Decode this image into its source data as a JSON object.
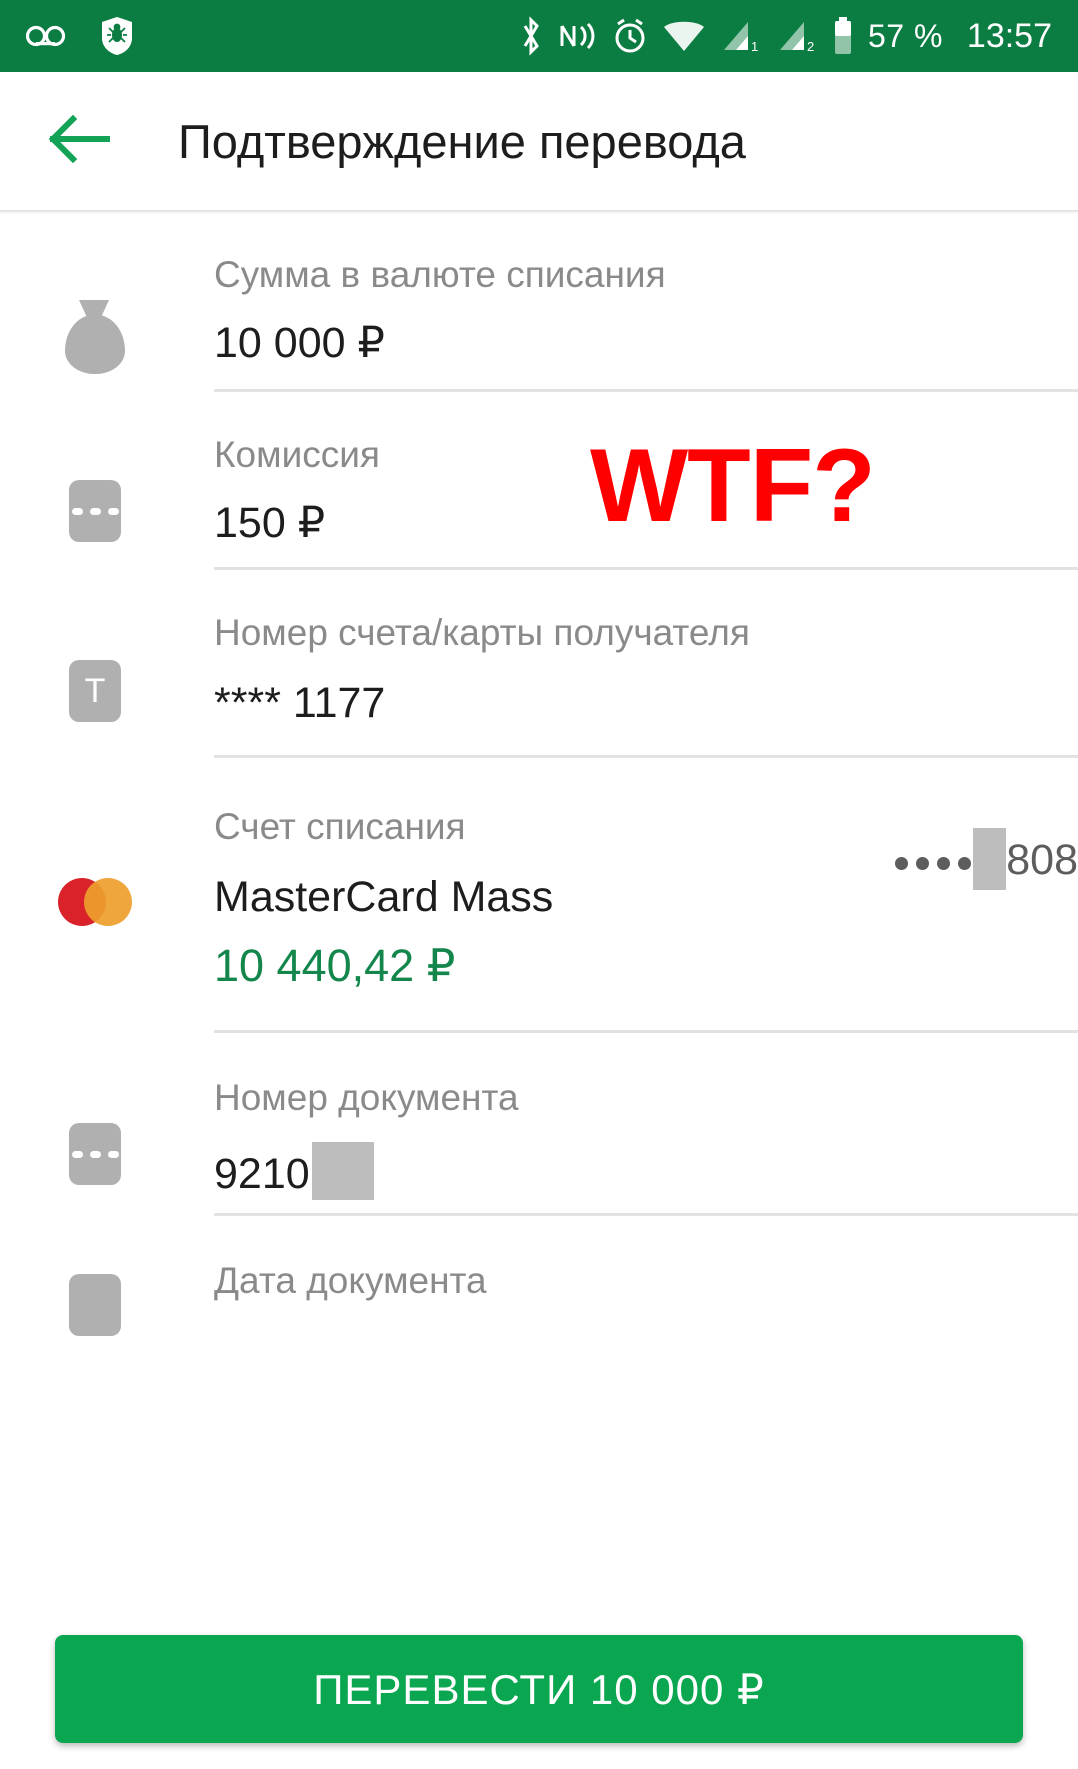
{
  "status_bar": {
    "background_color": "#0c7d42",
    "left_icons": [
      "voicemail-icon",
      "drweb-shield-icon"
    ],
    "right_icons": [
      "bluetooth-icon",
      "nfc-icon",
      "alarm-icon",
      "wifi-icon",
      "signal-1-icon",
      "signal-2-icon",
      "battery-icon"
    ],
    "signal_1_label": "1",
    "signal_2_label": "2",
    "battery_percent": "57 %",
    "time": "13:57"
  },
  "app_bar": {
    "back_icon": "arrow-left-icon",
    "title": "Подтверждение перевода",
    "accent_color": "#12864b"
  },
  "fields": [
    {
      "icon": "money-bag-icon",
      "label": "Сумма в валюте списания",
      "value": "10 000 ₽"
    },
    {
      "icon": "three-dots-box-icon",
      "label": "Комиссия",
      "value": "150 ₽"
    },
    {
      "icon": "letter-t-box-icon",
      "label": "Номер счета/карты получателя",
      "value": "**** 1177"
    },
    {
      "icon": "mastercard-icon",
      "label": "Счет списания",
      "value": "MasterCard Mass",
      "balance": "10 440,42 ₽",
      "card_dots": "••••",
      "card_suffix": "808"
    },
    {
      "icon": "three-dots-box-icon",
      "label": "Номер документа",
      "value": "9210"
    },
    {
      "icon": "grey-box-icon",
      "label": "Дата документа",
      "value": ""
    }
  ],
  "annotation": {
    "text": "WTF?",
    "color": "#ff0000"
  },
  "cta": {
    "label": "ПЕРЕВЕСТИ 10 000 ₽",
    "color": "#0aa650"
  }
}
